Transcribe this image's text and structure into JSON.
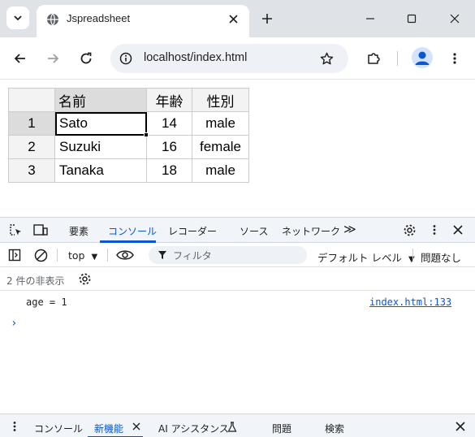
{
  "browser": {
    "tab_title": "Jspreadsheet",
    "url": "localhost/index.html",
    "icons": {
      "tab_search": "chevron-down-icon",
      "favicon": "globe-icon",
      "tab_close": "close-icon",
      "new_tab": "plus-icon",
      "minimize": "minimize-icon",
      "maximize": "maximize-icon",
      "close_window": "close-icon",
      "back": "arrow-left-icon",
      "forward": "arrow-right-icon",
      "reload": "reload-icon",
      "site_info": "site-info-icon",
      "bookmark": "star-icon",
      "extensions": "puzzle-icon",
      "profile": "person-icon",
      "menu": "kebab-icon"
    }
  },
  "sheet": {
    "headers": [
      "名前",
      "年齢",
      "性別"
    ],
    "rows": [
      {
        "index": "1",
        "name": "Sato",
        "age": "14",
        "gender": "male"
      },
      {
        "index": "2",
        "name": "Suzuki",
        "age": "16",
        "gender": "female"
      },
      {
        "index": "3",
        "name": "Tanaka",
        "age": "18",
        "gender": "male"
      }
    ]
  },
  "devtools": {
    "tabs": [
      "要素",
      "コンソール",
      "レコーダー",
      "ソース",
      "ネットワーク"
    ],
    "active_tab": "コンソール",
    "more_tabs": "≫",
    "console_toolbar": {
      "context": "top",
      "filter_placeholder": "フィルタ",
      "levels": "デフォルト レベル",
      "issues": "問題なし"
    },
    "hidden_messages": "2 件の非表示",
    "log": {
      "message": "age = 1",
      "source": "index.html:133"
    },
    "prompt": "›",
    "drawer_tabs": [
      "コンソール",
      "新機能",
      "AI アシスタンス",
      "問題",
      "検索"
    ],
    "active_drawer_tab": "新機能",
    "colors": {
      "accent": "#0b57d0",
      "tabbar_bg": "#f1f4f9"
    }
  }
}
